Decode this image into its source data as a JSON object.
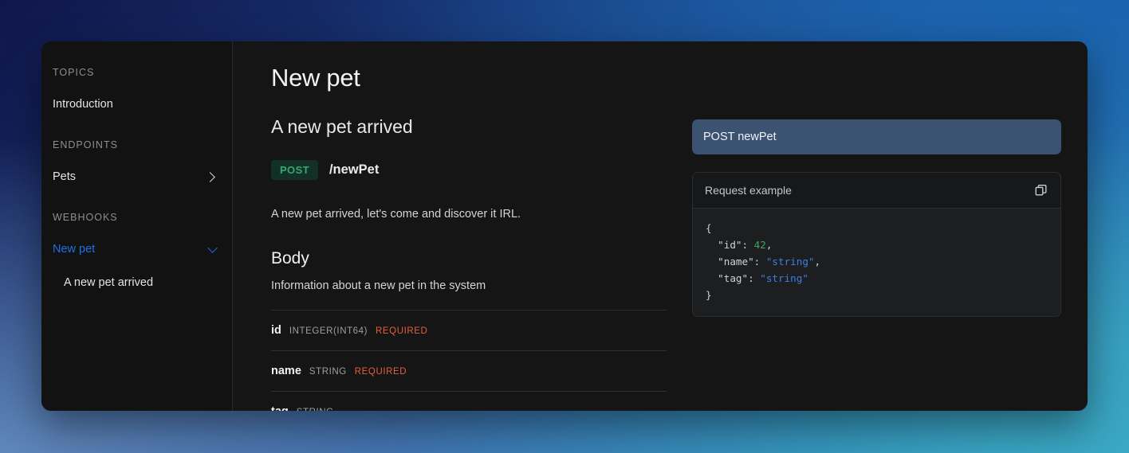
{
  "sidebar": {
    "sections": [
      {
        "label": "TOPICS",
        "items": [
          {
            "label": "Introduction",
            "icon": null,
            "state": "default"
          }
        ]
      },
      {
        "label": "ENDPOINTS",
        "items": [
          {
            "label": "Pets",
            "icon": "chevron-right-icon",
            "state": "collapsed"
          }
        ]
      },
      {
        "label": "WEBHOOKS",
        "items": [
          {
            "label": "New pet",
            "icon": "chevron-down-icon",
            "state": "expanded-active"
          },
          {
            "label": "A new pet arrived",
            "icon": null,
            "state": "sub-item"
          }
        ]
      }
    ]
  },
  "main": {
    "page_title": "New pet",
    "operation_title": "A new pet arrived",
    "method": "POST",
    "path": "/newPet",
    "operation_description": "A new pet arrived, let's come and discover it IRL.",
    "body": {
      "section_title": "Body",
      "section_description": "Information about a new pet in the system",
      "params": [
        {
          "name": "id",
          "type": "INTEGER(INT64)",
          "required": "REQUIRED"
        },
        {
          "name": "name",
          "type": "STRING",
          "required": "REQUIRED"
        },
        {
          "name": "tag",
          "type": "STRING",
          "required": ""
        }
      ]
    }
  },
  "side": {
    "endpoint_banner": "POST newPet",
    "code_card": {
      "title": "Request example",
      "copy_icon": "copy-icon",
      "lines": [
        {
          "parts": [
            {
              "t": "{",
              "k": "plain"
            }
          ]
        },
        {
          "parts": [
            {
              "t": "  \"id\": ",
              "k": "plain"
            },
            {
              "t": "42",
              "k": "num"
            },
            {
              "t": ",",
              "k": "plain"
            }
          ]
        },
        {
          "parts": [
            {
              "t": "  \"name\": ",
              "k": "plain"
            },
            {
              "t": "\"string\"",
              "k": "str"
            },
            {
              "t": ",",
              "k": "plain"
            }
          ]
        },
        {
          "parts": [
            {
              "t": "  \"tag\": ",
              "k": "plain"
            },
            {
              "t": "\"string\"",
              "k": "str"
            }
          ]
        },
        {
          "parts": [
            {
              "t": "}",
              "k": "plain"
            }
          ]
        }
      ]
    }
  },
  "colors": {
    "accent_blue": "#1f6fe5",
    "method_green": "#39a775",
    "method_green_bg": "#123026",
    "required_orange": "#e2603c",
    "banner_slate": "#3c5271",
    "code_string": "#3d7fe0",
    "code_number": "#3fa45f",
    "panel_bg": "#151515",
    "sidebar_bg": "#121212"
  }
}
